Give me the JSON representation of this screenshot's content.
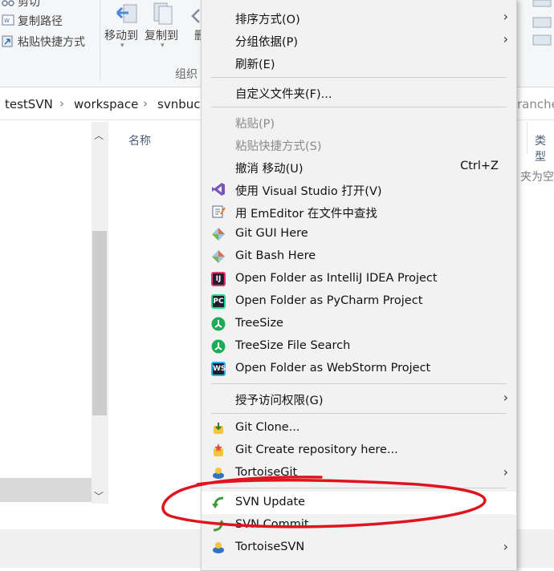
{
  "ribbon": {
    "cut": "剪切",
    "copy_path": "复制路径",
    "paste_shortcut": "粘贴快捷方式",
    "move_to": "移动到",
    "copy_to": "复制到",
    "group_label": "组织"
  },
  "breadcrumb": [
    "testSVN",
    "workspace",
    "svnbuck"
  ],
  "breadcrumb_right": "ranche",
  "list": {
    "col_name": "名称",
    "col_type": "类型",
    "empty_hint": "夹为空"
  },
  "menu": {
    "sort": "排序方式(O)",
    "group": "分组依据(P)",
    "refresh": "刷新(E)",
    "customize": "自定义文件夹(F)...",
    "paste": "粘贴(P)",
    "paste_shortcut": "粘贴快捷方式(S)",
    "undo": "撤消 移动(U)",
    "undo_shortcut": "Ctrl+Z",
    "vs": "使用 Visual Studio 打开(V)",
    "emeditor": "用 EmEditor 在文件中查找",
    "git_gui": "Git GUI Here",
    "git_bash": "Git Bash Here",
    "intellij": "Open Folder as IntelliJ IDEA Project",
    "pycharm": "Open Folder as PyCharm Project",
    "treesize": "TreeSize",
    "treesize_search": "TreeSize File Search",
    "webstorm": "Open Folder as WebStorm Project",
    "grant_access": "授予访问权限(G)",
    "git_clone": "Git Clone...",
    "git_create": "Git Create repository here...",
    "tortoisegit": "TortoiseGit",
    "svn_update": "SVN Update",
    "svn_commit": "SVN Commit...",
    "tortoisesvn": "TortoiseSVN"
  },
  "colors": {
    "menu_bg": "#f2f2f2",
    "annotation": "#e0141e",
    "vs": "#7b56b8",
    "intellij": "#1e1e2e",
    "pycharm": "#1e1e2e",
    "treesize": "#1faa5a",
    "webstorm": "#1e1e2e"
  }
}
